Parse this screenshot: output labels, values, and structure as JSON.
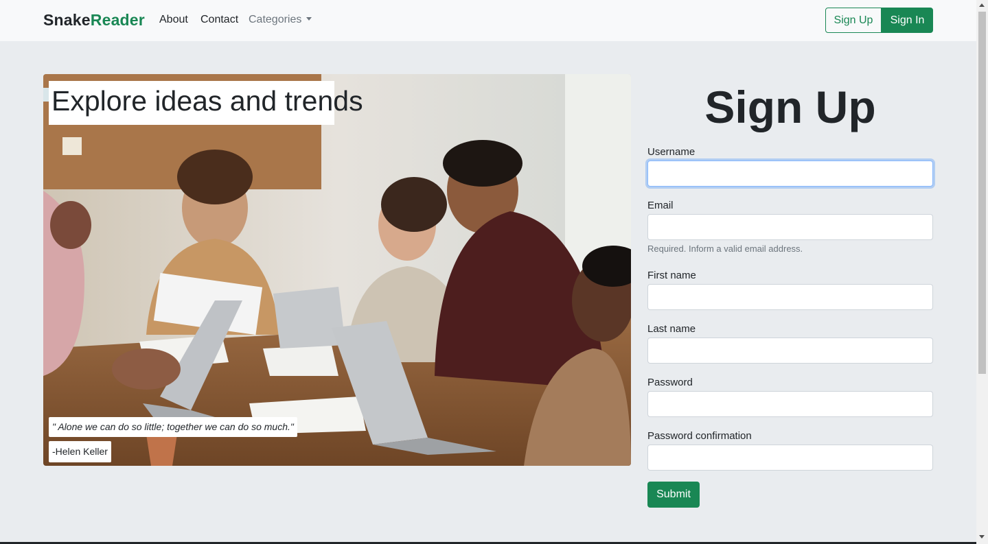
{
  "navbar": {
    "brand_part1": "Snake",
    "brand_part2": "Reader",
    "links": [
      "About",
      "Contact",
      "Categories"
    ],
    "signup_label": "Sign Up",
    "signin_label": "Sign In"
  },
  "hero": {
    "title": "Explore ideas and trends",
    "quote": "\" Alone we can do so little; together we can do so much.\"",
    "author": "-Helen Keller"
  },
  "form": {
    "title": "Sign Up",
    "fields": [
      {
        "label": "Username",
        "value": ""
      },
      {
        "label": "Email",
        "value": ""
      },
      {
        "label": "First name",
        "value": ""
      },
      {
        "label": "Last name",
        "value": ""
      },
      {
        "label": "Password",
        "value": ""
      },
      {
        "label": "Password confirmation",
        "value": ""
      }
    ],
    "email_help": "Required. Inform a valid email address.",
    "submit_label": "Submit"
  },
  "colors": {
    "accent": "#198754",
    "page_bg": "#e9ecef",
    "navbar_bg": "#f8f9fa"
  }
}
